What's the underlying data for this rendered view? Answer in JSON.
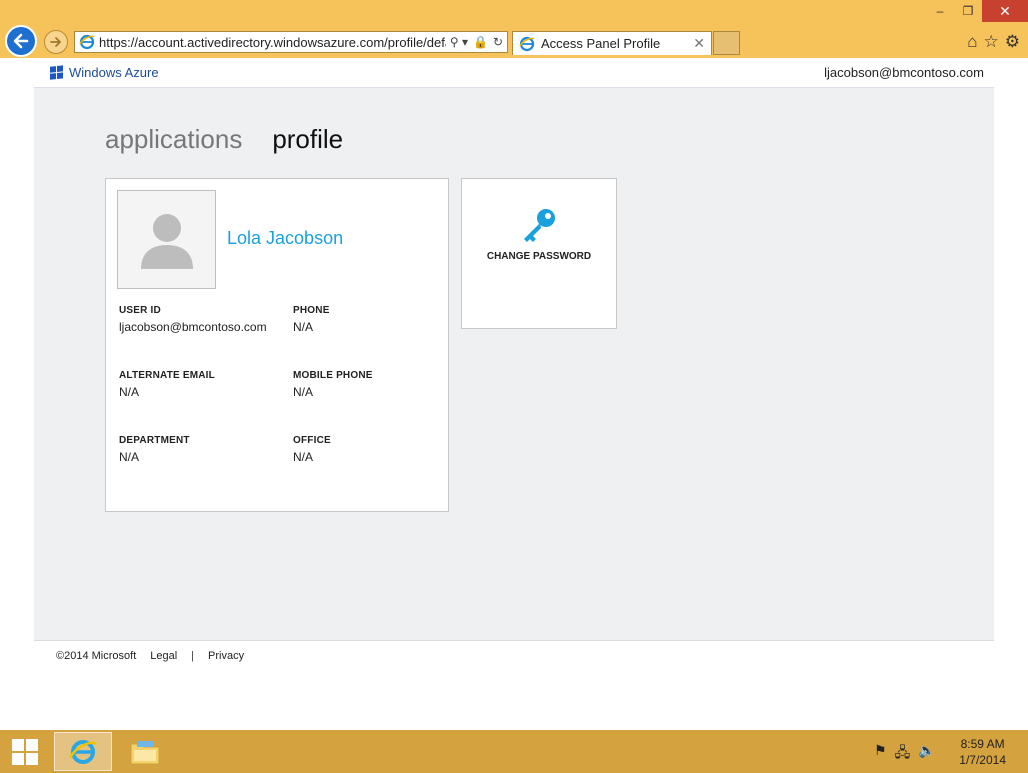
{
  "browser": {
    "url": "https://account.activedirectory.windowsazure.com/profile/defau",
    "tab_title": "Access Panel Profile",
    "min_glyph": "–",
    "restore_glyph": "❐",
    "close_glyph": "✕",
    "tab_close_glyph": "✕",
    "search_glyph": "⚲ ▾",
    "lock_glyph": "🔒",
    "refresh_glyph": "↻",
    "home_glyph": "⌂",
    "fav_glyph": "☆",
    "settings_glyph": "⚙"
  },
  "header": {
    "brand": "Windows Azure",
    "signed_in_user": "ljacobson@bmcontoso.com"
  },
  "nav": {
    "tabs": [
      {
        "label": "applications",
        "active": false
      },
      {
        "label": "profile",
        "active": true
      }
    ]
  },
  "profile": {
    "name": "Lola Jacobson",
    "fields": [
      {
        "label": "USER ID",
        "value": "ljacobson@bmcontoso.com"
      },
      {
        "label": "PHONE",
        "value": "N/A"
      },
      {
        "label": "ALTERNATE EMAIL",
        "value": "N/A"
      },
      {
        "label": "MOBILE PHONE",
        "value": "N/A"
      },
      {
        "label": "DEPARTMENT",
        "value": "N/A"
      },
      {
        "label": "OFFICE",
        "value": "N/A"
      }
    ]
  },
  "actions": {
    "change_password": "CHANGE PASSWORD"
  },
  "footer": {
    "copyright": "©2014 Microsoft",
    "legal": "Legal",
    "separator": "|",
    "privacy": "Privacy"
  },
  "taskbar": {
    "time": "8:59 AM",
    "date": "1/7/2014",
    "flag_glyph": "⚑",
    "network_glyph": "🖧",
    "volume_glyph": "🔈"
  },
  "colors": {
    "accent": "#1aa1dd",
    "chrome": "#f6c25a",
    "taskbar": "#d4a23f"
  }
}
